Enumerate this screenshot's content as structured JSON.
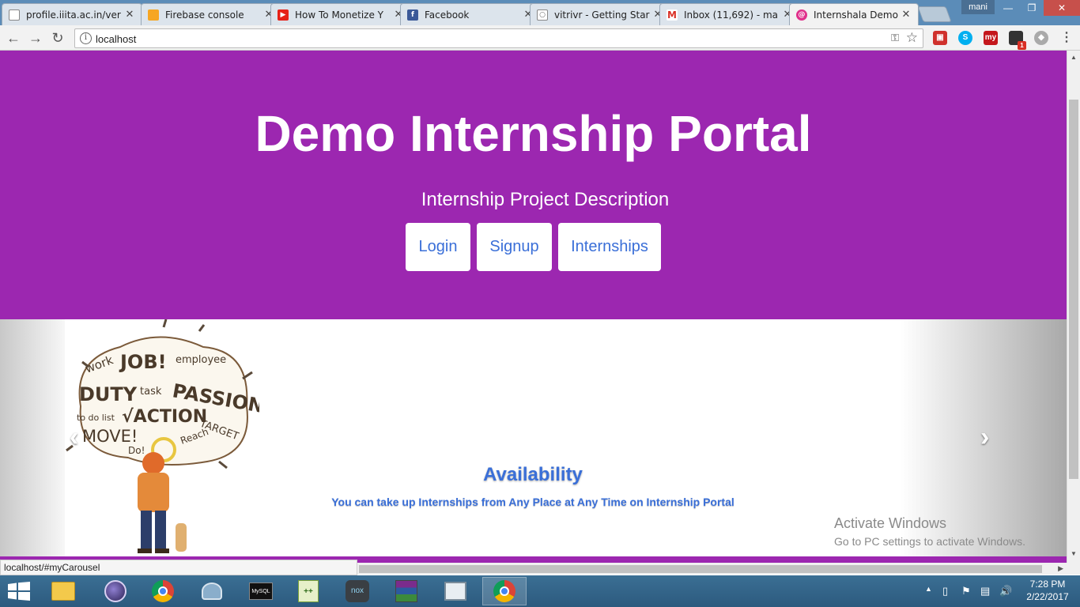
{
  "browser": {
    "tabs": [
      {
        "title": "profile.iiita.ac.in/ver",
        "icon": "document-icon",
        "active": false
      },
      {
        "title": "Firebase console",
        "icon": "firebase-icon",
        "active": false
      },
      {
        "title": "How To Monetize Y",
        "icon": "youtube-icon",
        "active": false
      },
      {
        "title": "Facebook",
        "icon": "facebook-icon",
        "active": false
      },
      {
        "title": "vitrivr - Getting Star",
        "icon": "search-icon",
        "active": false
      },
      {
        "title": "Inbox (11,692) - ma",
        "icon": "gmail-icon",
        "active": false
      },
      {
        "title": "Internshala Demo",
        "icon": "internshala-icon",
        "active": true
      }
    ],
    "close_glyph": "✕",
    "profile_name": "mani",
    "window_controls": {
      "minimize": "—",
      "restore": "❐",
      "close": "✕"
    },
    "nav": {
      "back": "←",
      "forward": "→",
      "reload": "↻"
    },
    "address": "localhost",
    "info_glyph": "i",
    "key_glyph": "⚿",
    "star_glyph": "☆",
    "extensions": [
      {
        "name": "pdf-extension-icon",
        "label": "▣",
        "color": "#d0312d"
      },
      {
        "name": "skype-icon",
        "label": "S",
        "color": "#00aff0"
      },
      {
        "name": "my-extension-icon",
        "label": "my",
        "color": "#c4161c"
      },
      {
        "name": "notification-extension-icon",
        "label": "1",
        "color": "#333333"
      },
      {
        "name": "cube-extension-icon",
        "label": "◆",
        "color": "#888888"
      }
    ],
    "menu_glyph": "⋮",
    "status_url": "localhost/#myCarousel"
  },
  "hero": {
    "title": "Demo Internship Portal",
    "description": "Internship Project Description",
    "buttons": {
      "login": "Login",
      "signup": "Signup",
      "internships": "Internships"
    },
    "color": "#9c27b0"
  },
  "carousel": {
    "prev_glyph": "‹",
    "next_glyph": "›",
    "slide_title": "Availability",
    "slide_text": "You can take up Internships from Any Place at Any Time on Internship Portal",
    "accent": "#3a6fd8"
  },
  "watermark": {
    "line1": "Activate Windows",
    "line2": "Go to PC settings to activate Windows."
  },
  "taskbar": {
    "apps": [
      "file-explorer-icon",
      "eclipse-icon",
      "chrome-icon",
      "snipping-tool-icon",
      "mysql-icon",
      "notepad-plus-icon",
      "nox-icon",
      "winrar-icon",
      "window-app-icon",
      "chrome-user-icon"
    ],
    "time": "7:28 PM",
    "date": "2/22/2017",
    "tray": {
      "chevron": "▲",
      "volume": "🔊"
    }
  }
}
